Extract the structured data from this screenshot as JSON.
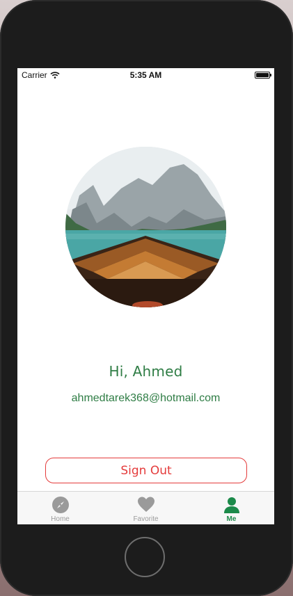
{
  "status_bar": {
    "carrier": "Carrier",
    "time": "5:35 AM"
  },
  "profile": {
    "greeting": "Hi, Ahmed",
    "email": "ahmedtarek368@hotmail.com"
  },
  "actions": {
    "sign_out": "Sign Out"
  },
  "tabs": [
    {
      "label": "Home",
      "icon": "compass-icon",
      "active": false
    },
    {
      "label": "Favorite",
      "icon": "heart-icon",
      "active": false
    },
    {
      "label": "Me",
      "icon": "person-icon",
      "active": true
    }
  ],
  "colors": {
    "accent_green": "#2f7d45",
    "active_tab_green": "#1c8a4a",
    "danger_red": "#e43b3b",
    "inactive_tab": "#9a9a9a"
  }
}
